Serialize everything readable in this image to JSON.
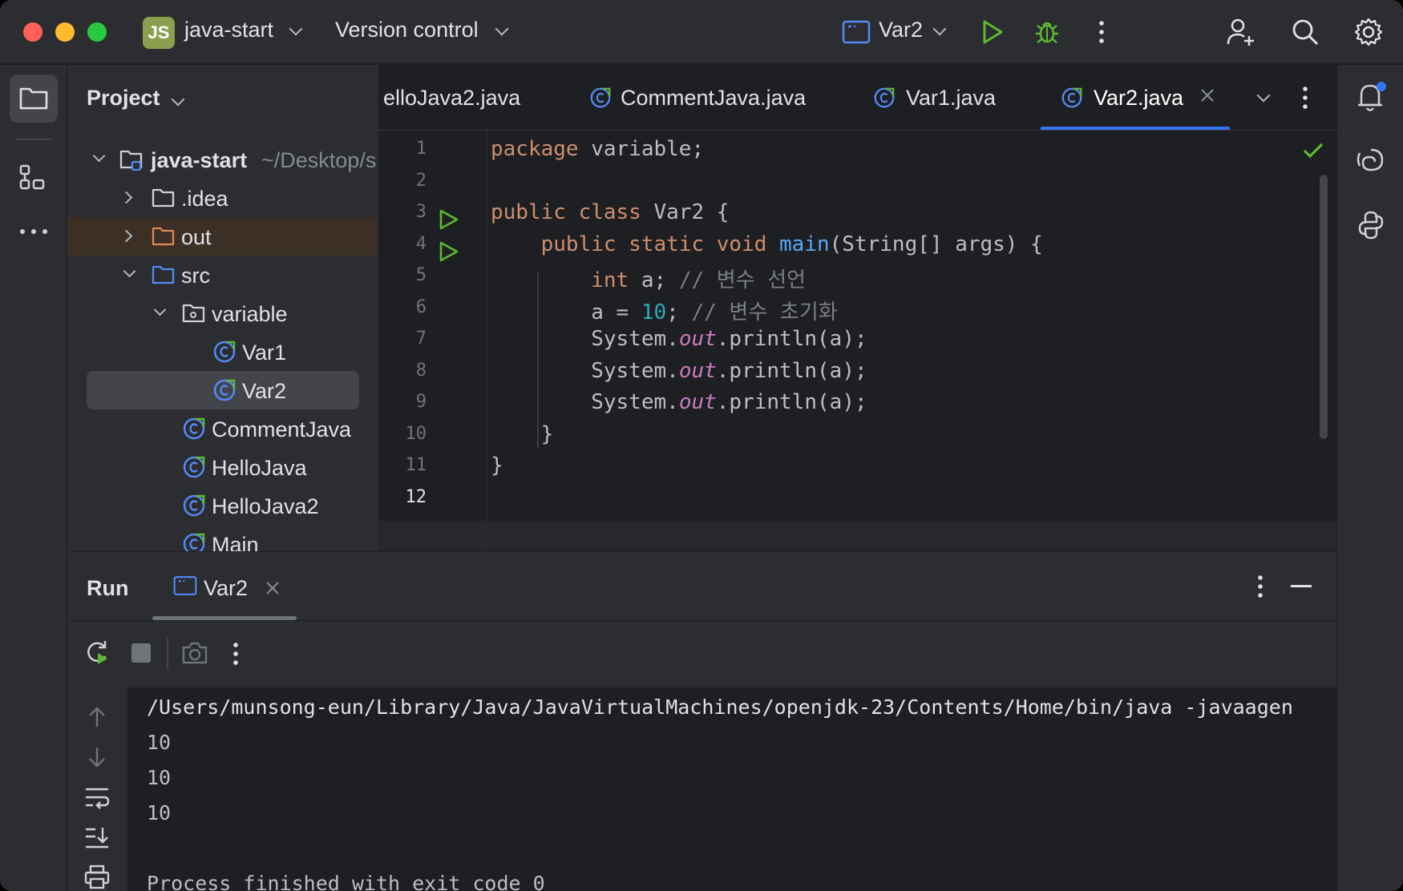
{
  "titlebar": {
    "project_badge": "JS",
    "project_name": "java-start",
    "vcs_label": "Version control",
    "run_config": "Var2"
  },
  "project_panel": {
    "header": "Project",
    "tree": [
      {
        "label": "java-start",
        "sub": "~/Desktop/s"
      },
      {
        "label": ".idea"
      },
      {
        "label": "out"
      },
      {
        "label": "src"
      },
      {
        "label": "variable"
      },
      {
        "label": "Var1"
      },
      {
        "label": "Var2"
      },
      {
        "label": "CommentJava"
      },
      {
        "label": "HelloJava"
      },
      {
        "label": "HelloJava2"
      },
      {
        "label": "Main"
      }
    ]
  },
  "editor": {
    "tabs": [
      {
        "label": "elloJava2.java"
      },
      {
        "label": "CommentJava.java"
      },
      {
        "label": "Var1.java"
      },
      {
        "label": "Var2.java"
      }
    ],
    "line_numbers": [
      "1",
      "2",
      "3",
      "4",
      "5",
      "6",
      "7",
      "8",
      "9",
      "10",
      "11",
      "12"
    ],
    "code": {
      "l1a": "package",
      "l1b": " variable;",
      "l3a": "public class",
      "l3b": " Var2 {",
      "l4a": "    public static void ",
      "l4b": "main",
      "l4c": "(String[] args) {",
      "l5a": "        int",
      "l5b": " a; ",
      "l5c": "// 변수 선언",
      "l6a": "        a = ",
      "l6b": "10",
      "l6c": "; ",
      "l6d": "// 변수 초기화",
      "l7a": "        System.",
      "l7b": "out",
      "l7c": ".println(a);",
      "l8a": "        System.",
      "l8b": "out",
      "l8c": ".println(a);",
      "l9a": "        System.",
      "l9b": "out",
      "l9c": ".println(a);",
      "l10": "    }",
      "l11": "}"
    }
  },
  "run_panel": {
    "title": "Run",
    "tab": "Var2",
    "console": [
      "/Users/munsong-eun/Library/Java/JavaVirtualMachines/openjdk-23/Contents/Home/bin/java -javaagen",
      "10",
      "10",
      "10",
      "",
      "Process finished with exit code 0"
    ]
  },
  "colors": {
    "accent": "#3574f0",
    "keyword": "#cf8e6d",
    "function": "#56a8f5",
    "number": "#2aacb8",
    "static_field": "#c77dbb",
    "run_green": "#5fb832"
  }
}
